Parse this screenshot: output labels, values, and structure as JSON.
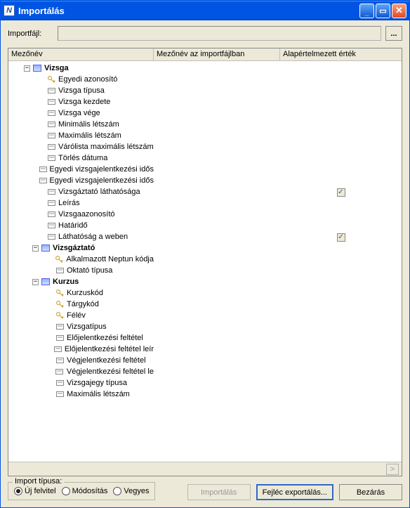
{
  "window": {
    "title": "Importálás"
  },
  "importfile": {
    "label": "Importfájl:",
    "value": "",
    "browse": "..."
  },
  "columns": {
    "c1": "Mezőnév",
    "c2": "Mezőnév az importfájlban",
    "c3": "Alapértelmezett érték"
  },
  "groups": [
    {
      "name": "Vizsga",
      "expanded": true,
      "items": [
        {
          "label": "Egyedi azonosító",
          "icon": "key"
        },
        {
          "label": "Vizsga típusa",
          "icon": "field"
        },
        {
          "label": "Vizsga kezdete",
          "icon": "field"
        },
        {
          "label": "Vizsga vége",
          "icon": "field"
        },
        {
          "label": "Minimális létszám",
          "icon": "field"
        },
        {
          "label": "Maximális létszám",
          "icon": "field"
        },
        {
          "label": "Várólista maximális létszám",
          "icon": "field"
        },
        {
          "label": "Törlés dátuma",
          "icon": "field"
        },
        {
          "label": "Egyedi vizsgajelentkezési idős",
          "icon": "field"
        },
        {
          "label": "Egyedi vizsgajelentkezési idős",
          "icon": "field"
        },
        {
          "label": "Vizsgáztató láthatósága",
          "icon": "field",
          "checked": true
        },
        {
          "label": "Leírás",
          "icon": "field"
        },
        {
          "label": "Vizsgaazonosító",
          "icon": "field"
        },
        {
          "label": "Határidő",
          "icon": "field"
        },
        {
          "label": "Láthatóság a weben",
          "icon": "field",
          "checked": true
        }
      ]
    },
    {
      "name": "Vizsgáztató",
      "expanded": true,
      "items": [
        {
          "label": "Alkalmazott Neptun kódja",
          "icon": "key"
        },
        {
          "label": "Oktató típusa",
          "icon": "field"
        }
      ]
    },
    {
      "name": "Kurzus",
      "expanded": true,
      "items": [
        {
          "label": "Kurzuskód",
          "icon": "key"
        },
        {
          "label": "Tárgykód",
          "icon": "key"
        },
        {
          "label": "Félév",
          "icon": "key"
        },
        {
          "label": "Vizsgatípus",
          "icon": "field"
        },
        {
          "label": "Előjelentkezési feltétel",
          "icon": "field"
        },
        {
          "label": "Előjelentkezési feltétel leír",
          "icon": "field"
        },
        {
          "label": "Végjelentkezési feltétel",
          "icon": "field"
        },
        {
          "label": "Végjelentkezési feltétel le",
          "icon": "field"
        },
        {
          "label": "Vizsgajegy típusa",
          "icon": "field"
        },
        {
          "label": "Maximális létszám",
          "icon": "field"
        }
      ]
    }
  ],
  "importType": {
    "legend": "Import típusa:",
    "options": [
      "Új felvitel",
      "Módosítás",
      "Vegyes"
    ],
    "selected": 0
  },
  "buttons": {
    "import": "Importálás",
    "exportHeader": "Fejléc exportálás...",
    "close": "Bezárás"
  },
  "titlebar": {
    "min": "_",
    "max": "□",
    "close": "✕"
  }
}
